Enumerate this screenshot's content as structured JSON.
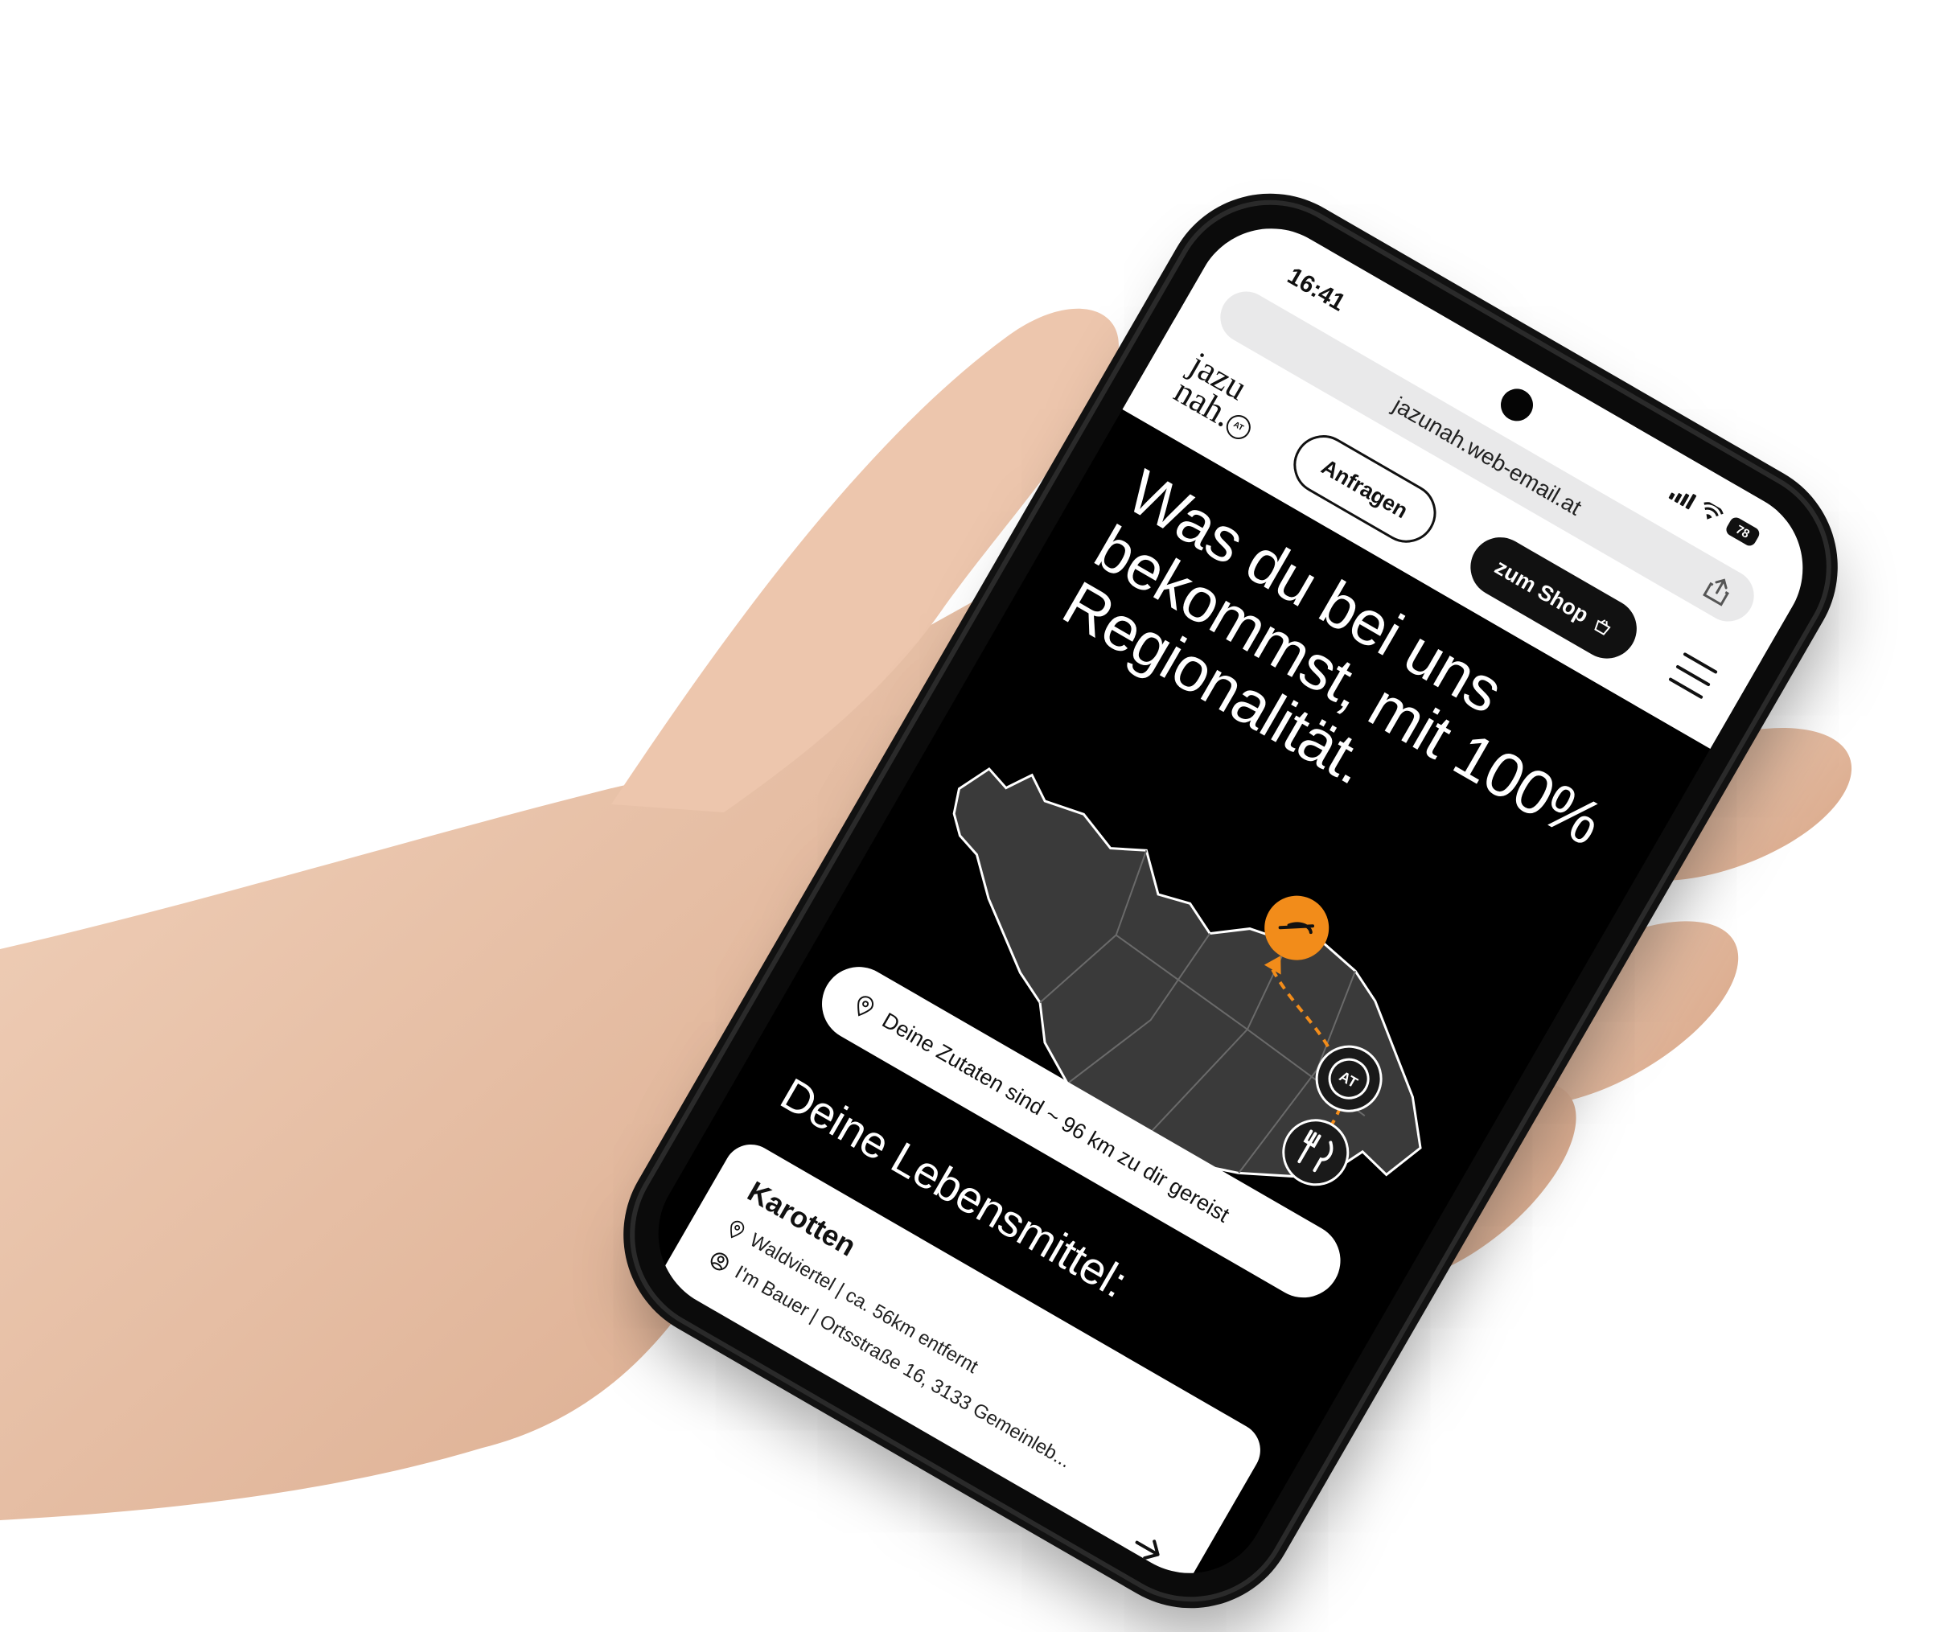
{
  "status": {
    "time": "16:41",
    "battery": "78"
  },
  "browser": {
    "url": "jazunah.web-email.at"
  },
  "site": {
    "logo_line1": "jazu",
    "logo_line2": "nah.",
    "logo_badge": "AT",
    "nav_request": "Anfragen",
    "nav_shop": "zum Shop"
  },
  "hero": {
    "headline": "Was du bei uns bekommst, mit  100% Regionalität."
  },
  "map": {
    "markers": [
      {
        "name": "carrot-marker",
        "color": "#f28c1a"
      },
      {
        "name": "at-marker",
        "label": "AT"
      },
      {
        "name": "restaurant-marker"
      }
    ],
    "route_color": "#f28c1a"
  },
  "distance": {
    "text": "Deine Zutaten sind ~ 96 km  zu dir gereist"
  },
  "section": {
    "title": "Deine Lebensmittel:"
  },
  "card": {
    "title": "Karotten",
    "location": "Waldviertel | ca. 56km entfernt",
    "farmer": "I'm Bauer | Ortsstraße 16,  3133 Gemeinleb..."
  },
  "colors": {
    "accent": "#f28c1a",
    "screen_bg": "#000000",
    "map_fill": "#3a3a3a"
  }
}
